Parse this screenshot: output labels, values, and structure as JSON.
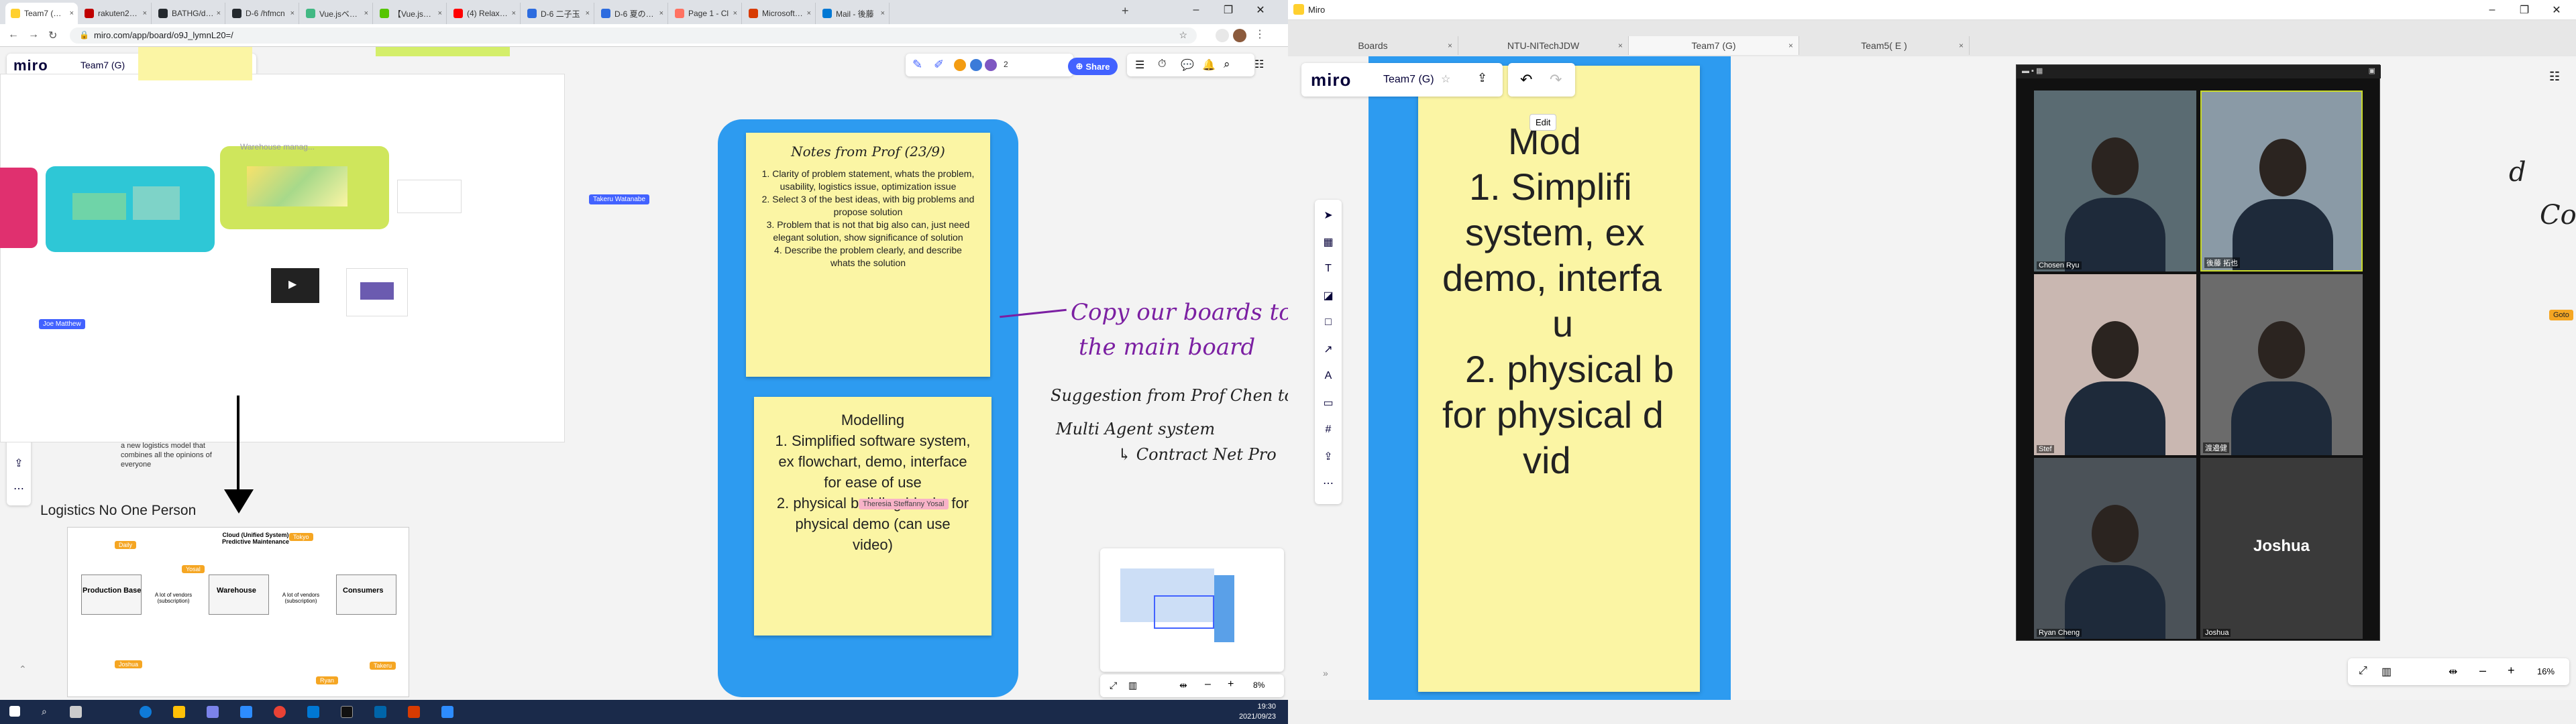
{
  "left_browser": {
    "tabs": [
      {
        "title": "Team7 (G), Onli",
        "active": true,
        "color": "#ffd02f"
      },
      {
        "title": "rakuten2021",
        "color": "#bf0000"
      },
      {
        "title": "BATHG/deplo",
        "color": "#24292e"
      },
      {
        "title": "D-6 /hfmcn",
        "color": "#24292e"
      },
      {
        "title": "Vue.jsベース",
        "color": "#41b883"
      },
      {
        "title": "【Vue.js+Fire",
        "color": "#55c500"
      },
      {
        "title": "(4) Relaxing Ja",
        "color": "#ff0000"
      },
      {
        "title": "D-6 二子玉",
        "color": "#2d6cdf"
      },
      {
        "title": "D-6 夏の議事",
        "color": "#2d6cdf"
      },
      {
        "title": "Page 1 - Cl",
        "color": "#ff7262"
      },
      {
        "title": "Microsoft Of",
        "color": "#d83b01"
      },
      {
        "title": "Mail - 後藤",
        "color": "#0078d4"
      }
    ],
    "tab_close": "×",
    "new_tab": "+",
    "url": "miro.com/app/board/o9J_lymnL20=/",
    "nav": {
      "back": "←",
      "forward": "→",
      "reload": "↻"
    }
  },
  "left_miro": {
    "logo": "miro",
    "board_name": "Team7 (G)",
    "share_label": "Share",
    "collab_count": "2",
    "undo": "↶",
    "redo": "↷",
    "cursor_labels": [
      "Takeru Watanabe",
      "Joe Matthew",
      "Theresia Steffanny Yosal"
    ],
    "sticky_notes": {
      "prof_notes_title": "Notes from Prof (23/9)",
      "prof_notes_body": "1. Clarity of problem statement, whats the problem, usability, logistics issue, optimization issue\n2. Select 3 of the best ideas, with big problems and propose solution\n3. Problem that is not that big also can, just need elegant solution, show significance of  solution\n4. Describe the problem clearly, and describe whats the solution",
      "modelling_title": "Modelling",
      "modelling_body": "1. Simplified software system, ex flowchart, demo, interface for ease of use\n2. physical building blocks for physical demo (can use video)"
    },
    "handwriting": {
      "copy_line1": "Copy our boards to",
      "copy_line2": "the main board",
      "suggestion": "Suggestion from Prof Chen to",
      "multi": "Multi Agent system",
      "contract": "↳ Contract Net Pro"
    },
    "frame_text": {
      "new_model": "a new logistics model that combines all the opinions of everyone",
      "logistics_title": "Logistics No One Person",
      "warehouse_note": "Warehouse manag...",
      "diagram_cloud": "Cloud (Unified System) Predictive Maintenance",
      "diagram_labels": [
        "Production Base",
        "Warehouse",
        "Consumers",
        "A lot of vendors (subscription)",
        "A lot of vendors (subscription)"
      ],
      "diagram_tags": [
        "Daily",
        "Tokyo",
        "Yosal",
        "Joshua",
        "Takeru",
        "Ryan"
      ]
    },
    "zoom": "8%",
    "colors": {
      "accent": "#4262ff",
      "frame_blue": "#2d9bf0",
      "sticky": "#fbf5a4",
      "purple_ink": "#7b1fa2"
    }
  },
  "taskbar": {
    "time": "19:30",
    "date": "2021/09/23"
  },
  "right_app": {
    "window_title": "Miro",
    "tabs": [
      {
        "title": "Boards"
      },
      {
        "title": "NTU-NITechJDW"
      },
      {
        "title": "Team7 (G)",
        "active": true
      },
      {
        "title": "Team5( E )"
      }
    ],
    "logo": "miro",
    "board_name": "Team7 (G)",
    "edit_label": "Edit",
    "zoom": "16%",
    "goto_label": "Goto",
    "big_sticky_lines": [
      "Mod",
      "1. Simplifi",
      "system, ex",
      "demo, interfa",
      "u",
      "2. physical b",
      "for physical d",
      "vid"
    ],
    "video_participants": [
      {
        "name": "Chosen Ryu"
      },
      {
        "name": "後藤 拓也"
      },
      {
        "name": "Stef"
      },
      {
        "name": "渡邉健"
      },
      {
        "name": "Ryan Cheng"
      },
      {
        "name": "Joshua"
      }
    ],
    "joshua_center": "Joshua"
  }
}
